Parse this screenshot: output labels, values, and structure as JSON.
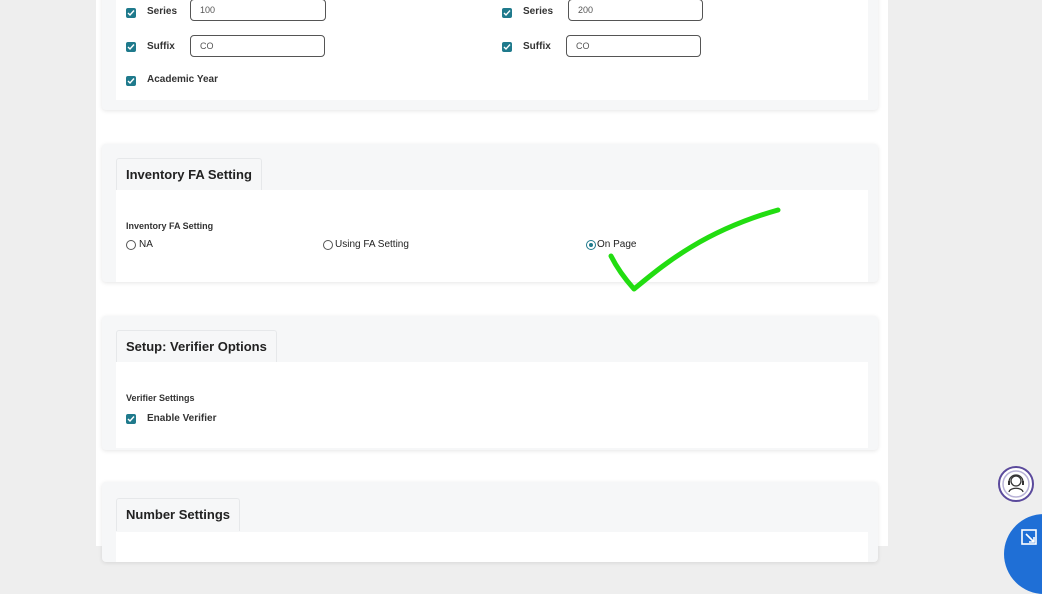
{
  "series_section": {
    "left": {
      "series_label": "Series",
      "series_value": "100",
      "suffix_label": "Suffix",
      "suffix_value": "CO",
      "academic_year_label": "Academic Year"
    },
    "right": {
      "series_label": "Series",
      "series_value": "200",
      "suffix_label": "Suffix",
      "suffix_value": "CO"
    }
  },
  "inventory": {
    "tab_title": "Inventory FA Setting",
    "sub_label": "Inventory FA Setting",
    "options": [
      "NA",
      "Using FA Setting",
      "On Page"
    ],
    "selected": "On Page"
  },
  "verifier": {
    "tab_title": "Setup: Verifier Options",
    "sub_label": "Verifier Settings",
    "enable_label": "Enable Verifier"
  },
  "number": {
    "tab_title": "Number Settings"
  },
  "colors": {
    "accent": "#1f7a8c",
    "checkmark_annotation": "#22dd11",
    "fab_blue": "#1f6fd6",
    "support_ring": "#5b4a9c"
  },
  "icons": {
    "support": "headset-agent-icon",
    "corner": "resize-arrow-icon",
    "annotation": "hand-drawn-checkmark"
  }
}
